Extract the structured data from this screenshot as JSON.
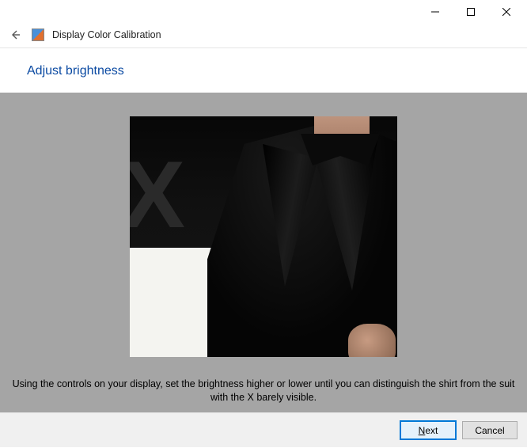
{
  "window": {
    "title": "Display Color Calibration"
  },
  "page": {
    "heading": "Adjust brightness",
    "instruction": "Using the controls on your display, set the brightness higher or lower until you can distinguish the shirt from the suit with the X barely visible."
  },
  "buttons": {
    "next": "Next",
    "cancel": "Cancel"
  }
}
